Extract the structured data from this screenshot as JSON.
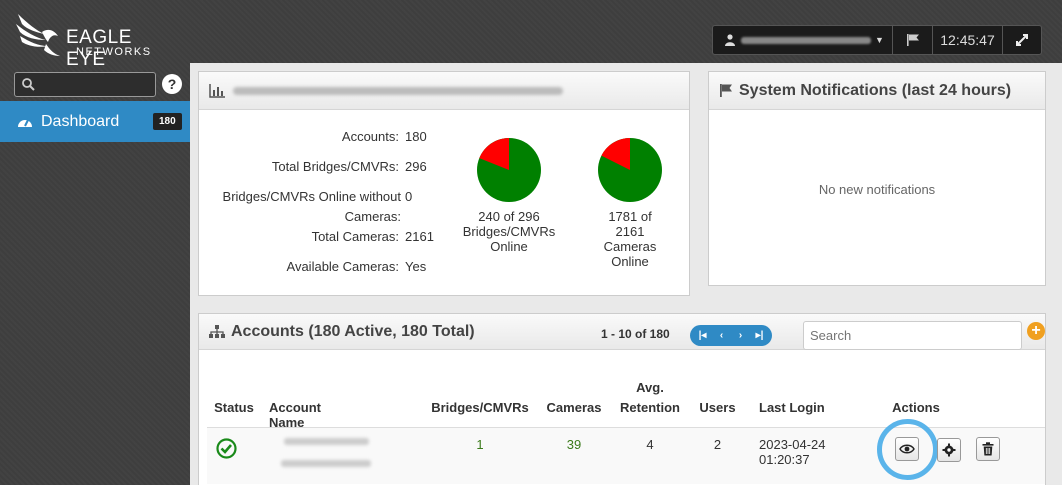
{
  "brand": {
    "line1": "EAGLE EYE",
    "line2": "NETWORKS"
  },
  "topbar": {
    "user_placeholder": "",
    "time": "12:45:47"
  },
  "sidebar": {
    "search": {
      "value": "",
      "placeholder": ""
    },
    "help_label": "?",
    "items": [
      {
        "label": "Dashboard",
        "badge": "180",
        "active": true
      }
    ]
  },
  "summary_panel": {
    "stats": [
      {
        "label": "Accounts:",
        "value": "180"
      },
      {
        "label": "Total Bridges/CMVRs:",
        "value": "296"
      },
      {
        "label": "Bridges/CMVRs Online without",
        "label2": "Cameras:",
        "value": "0"
      },
      {
        "label": "Total Cameras:",
        "value": "2161"
      },
      {
        "label": "Available Cameras:",
        "value": "Yes"
      }
    ],
    "pies": [
      {
        "caption": [
          "240 of 296",
          "Bridges/CMVRs",
          "Online"
        ],
        "online": 240,
        "total": 296
      },
      {
        "caption": [
          "1781 of",
          "2161",
          "Cameras",
          "Online"
        ],
        "online": 1781,
        "total": 2161
      }
    ]
  },
  "notifications": {
    "title": "System Notifications (last 24 hours)",
    "empty": "No new notifications"
  },
  "accounts": {
    "title": "Accounts (180 Active, 180 Total)",
    "pager": "1 - 10 of 180",
    "search_placeholder": "Search",
    "columns": {
      "status": "Status",
      "name": "Account Name",
      "bridges": "Bridges/CMVRs",
      "cameras": "Cameras",
      "retention1": "Avg.",
      "retention2": "Retention",
      "users": "Users",
      "last_login": "Last Login",
      "actions": "Actions"
    },
    "rows": [
      {
        "bridges": "1",
        "cameras": "39",
        "retention": "4",
        "users": "2",
        "last_login": "2023-04-24 01:20:37"
      }
    ]
  },
  "colors": {
    "accent": "#2f8ac5",
    "pie_online": "#008000",
    "pie_offline": "#ff0000",
    "link_green": "#3a7a1a",
    "highlight_ring": "#5ab4ea",
    "add_orange": "#f0a020"
  }
}
